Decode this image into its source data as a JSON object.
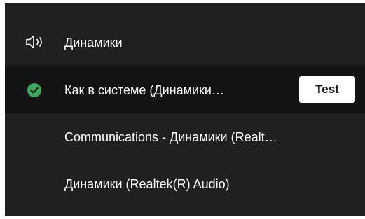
{
  "header": {
    "icon": "speaker-icon",
    "label": "Динамики"
  },
  "devices": [
    {
      "label": "Как в системе (Динамики…",
      "selected": true,
      "icon": "checkmark-circle-icon",
      "action_label": "Test"
    },
    {
      "label": "Communications - Динамики (Realt…",
      "selected": false
    },
    {
      "label": "Динамики (Realtek(R) Audio)",
      "selected": false
    }
  ],
  "colors": {
    "panel_background": "#202020",
    "selected_row_background": "#131313",
    "text": "#ffffff",
    "check": "#3ea85f",
    "button_background": "#ffffff"
  }
}
